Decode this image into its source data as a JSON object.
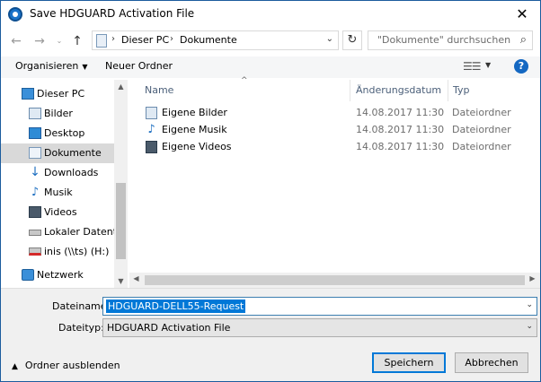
{
  "window": {
    "title": "Save HDGUARD Activation File",
    "close_label": "✕"
  },
  "address": {
    "segments": [
      "Dieser PC",
      "Dokumente"
    ],
    "search_placeholder": "\"Dokumente\" durchsuchen"
  },
  "toolbar": {
    "organize_label": "Organisieren",
    "new_folder_label": "Neuer Ordner",
    "help_label": "?"
  },
  "sidebar": {
    "items": [
      {
        "label": "Dieser PC",
        "icon": "computer-icon"
      },
      {
        "label": "Bilder",
        "icon": "pictures-icon"
      },
      {
        "label": "Desktop",
        "icon": "desktop-icon"
      },
      {
        "label": "Dokumente",
        "icon": "documents-icon",
        "selected": true
      },
      {
        "label": "Downloads",
        "icon": "downloads-icon"
      },
      {
        "label": "Musik",
        "icon": "music-icon"
      },
      {
        "label": "Videos",
        "icon": "videos-icon"
      },
      {
        "label": "Lokaler Datenträ",
        "icon": "local-disk-icon"
      },
      {
        "label": "inis (\\\\ts) (H:)",
        "icon": "network-drive-icon"
      },
      {
        "label": "Netzwerk",
        "icon": "network-icon"
      }
    ]
  },
  "filelist": {
    "columns": {
      "name": "Name",
      "date": "Änderungsdatum",
      "type": "Typ"
    },
    "rows": [
      {
        "name": "Eigene Bilder",
        "date": "14.08.2017 11:30",
        "type": "Dateiordner",
        "icon": "pictures-icon"
      },
      {
        "name": "Eigene Musik",
        "date": "14.08.2017 11:30",
        "type": "Dateiordner",
        "icon": "music-icon"
      },
      {
        "name": "Eigene Videos",
        "date": "14.08.2017 11:30",
        "type": "Dateiordner",
        "icon": "videos-icon"
      }
    ]
  },
  "form": {
    "filename_label": "Dateiname:",
    "filename_value": "HDGUARD-DELL55-Request",
    "filetype_label": "Dateityp:",
    "filetype_value": "HDGUARD Activation File"
  },
  "footer": {
    "hide_folders_label": "Ordner ausblenden",
    "save_label": "Speichern",
    "cancel_label": "Abbrechen"
  }
}
